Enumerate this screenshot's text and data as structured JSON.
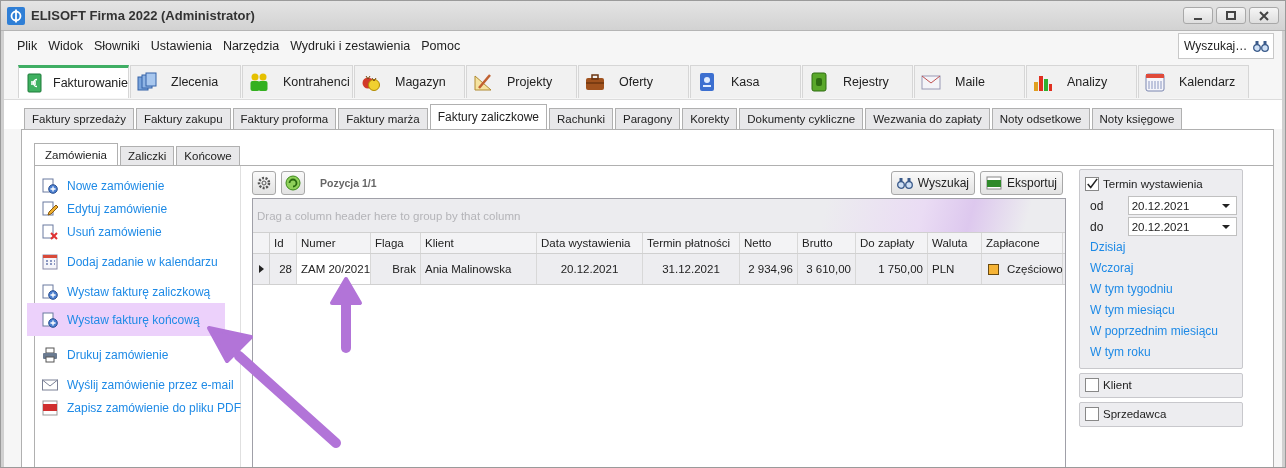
{
  "window": {
    "title": "ELISOFT Firma 2022 (Administrator)"
  },
  "menu": [
    "Plik",
    "Widok",
    "Słowniki",
    "Ustawienia",
    "Narzędzia",
    "Wydruki i zestawienia",
    "Pomoc"
  ],
  "search": {
    "placeholder": "Wyszukaj…"
  },
  "modules": [
    {
      "label": "Fakturowanie",
      "kind": "invoice",
      "selected": true
    },
    {
      "label": "Zlecenia",
      "kind": "copies",
      "selected": false
    },
    {
      "label": "Kontrahenci",
      "kind": "people",
      "selected": false
    },
    {
      "label": "Magazyn",
      "kind": "bags",
      "selected": false
    },
    {
      "label": "Projekty",
      "kind": "drafting",
      "selected": false
    },
    {
      "label": "Oferty",
      "kind": "briefcase",
      "selected": false
    },
    {
      "label": "Kasa",
      "kind": "cash",
      "selected": false
    },
    {
      "label": "Rejestry",
      "kind": "ledger",
      "selected": false
    },
    {
      "label": "Maile",
      "kind": "mail",
      "selected": false
    },
    {
      "label": "Analizy",
      "kind": "bars",
      "selected": false
    },
    {
      "label": "Kalendarz",
      "kind": "calendar",
      "selected": false
    }
  ],
  "subtabs": [
    {
      "label": "Faktury sprzedaży",
      "selected": false
    },
    {
      "label": "Faktury zakupu",
      "selected": false
    },
    {
      "label": "Faktury proforma",
      "selected": false
    },
    {
      "label": "Faktury marża",
      "selected": false
    },
    {
      "label": "Faktury zaliczkowe",
      "selected": true
    },
    {
      "label": "Rachunki",
      "selected": false
    },
    {
      "label": "Paragony",
      "selected": false
    },
    {
      "label": "Korekty",
      "selected": false
    },
    {
      "label": "Dokumenty cykliczne",
      "selected": false
    },
    {
      "label": "Wezwania do zapłaty",
      "selected": false
    },
    {
      "label": "Noty odsetkowe",
      "selected": false
    },
    {
      "label": "Noty księgowe",
      "selected": false
    }
  ],
  "inner_tabs": [
    {
      "label": "Zamówienia",
      "selected": true
    },
    {
      "label": "Zaliczki",
      "selected": false
    },
    {
      "label": "Końcowe",
      "selected": false
    }
  ],
  "actions": [
    [
      {
        "label": "Nowe zamówienie",
        "kind": "new",
        "highlighted": false
      },
      {
        "label": "Edytuj zamówienie",
        "kind": "edit",
        "highlighted": false
      },
      {
        "label": "Usuń zamówienie",
        "kind": "delete",
        "highlighted": false
      }
    ],
    [
      {
        "label": "Dodaj zadanie w kalendarzu",
        "kind": "calendar",
        "highlighted": false
      }
    ],
    [
      {
        "label": "Wystaw fakturę zaliczkową",
        "kind": "new",
        "highlighted": false
      },
      {
        "label": "Wystaw fakturę końcową",
        "kind": "new",
        "highlighted": true
      }
    ],
    [
      {
        "label": "Drukuj zamówienie",
        "kind": "print",
        "highlighted": false
      }
    ],
    [
      {
        "label": "Wyślij zamówienie przez e-mail",
        "kind": "mail",
        "highlighted": false
      },
      {
        "label": "Zapisz zamówienie do pliku PDF",
        "kind": "pdf",
        "highlighted": false
      }
    ]
  ],
  "toolbar": {
    "position": "Pozycja 1/1",
    "buttons": [
      {
        "label": "Wyszukaj",
        "kind": "binoculars"
      },
      {
        "label": "Eksportuj",
        "kind": "xls"
      }
    ]
  },
  "grid": {
    "group_hint": "Drag a column header here to group by that column",
    "columns": [
      "Id",
      "Numer",
      "Flaga",
      "Klient",
      "Data wystawienia",
      "Termin płatności",
      "Netto",
      "Brutto",
      "Do zapłaty",
      "Waluta",
      "Zapłacone"
    ],
    "rows": [
      {
        "current": true,
        "cells": [
          "28",
          "ZAM 20/2021",
          "Brak",
          "Ania Malinowska",
          "20.12.2021",
          "31.12.2021",
          "2 934,96",
          "3 610,00",
          "1 750,00",
          "PLN"
        ],
        "paid": {
          "label": "Częściowo",
          "color": "#f5b335"
        }
      }
    ]
  },
  "filters": {
    "date": {
      "label": "Termin wystawienia",
      "checked": true,
      "from_label": "od",
      "from": "20.12.2021",
      "to_label": "do",
      "to": "20.12.2021",
      "links": [
        "Dzisiaj",
        "Wczoraj",
        "W tym tygodniu",
        "W tym miesiącu",
        "W poprzednim miesiącu",
        "W tym roku"
      ]
    },
    "others": [
      {
        "label": "Klient",
        "checked": false
      },
      {
        "label": "Sprzedawca",
        "checked": false
      }
    ]
  }
}
